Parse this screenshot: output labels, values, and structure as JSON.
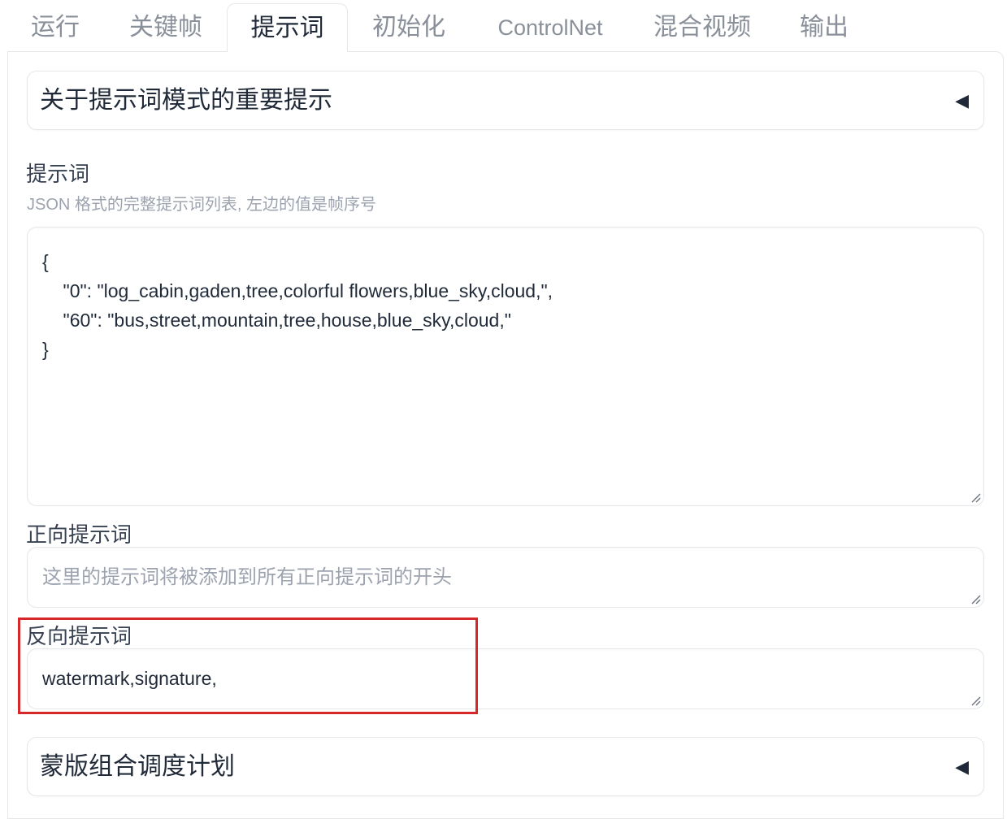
{
  "tabs": [
    {
      "label": "运行"
    },
    {
      "label": "关键帧"
    },
    {
      "label": "提示词",
      "active": true
    },
    {
      "label": "初始化"
    },
    {
      "label": "ControlNet"
    },
    {
      "label": "混合视频"
    },
    {
      "label": "输出"
    }
  ],
  "notice_accordion": {
    "title": "关于提示词模式的重要提示",
    "collapsed": true
  },
  "prompts": {
    "label": "提示词",
    "info": "JSON 格式的完整提示词列表, 左边的值是帧序号",
    "value": "{\n    \"0\": \"log_cabin,gaden,tree,colorful flowers,blue_sky,cloud,\",\n    \"60\": \"bus,street,mountain,tree,house,blue_sky,cloud,\"\n}"
  },
  "positive_prompt": {
    "label": "正向提示词",
    "value": "",
    "placeholder": "这里的提示词将被添加到所有正向提示词的开头"
  },
  "negative_prompt": {
    "label": "反向提示词",
    "value": "watermark,signature,"
  },
  "mask_accordion": {
    "title": "蒙版组合调度计划",
    "collapsed": true
  },
  "colors": {
    "highlight": "#d62828",
    "border": "#e5e7eb",
    "tab_inactive": "#8a909a"
  }
}
